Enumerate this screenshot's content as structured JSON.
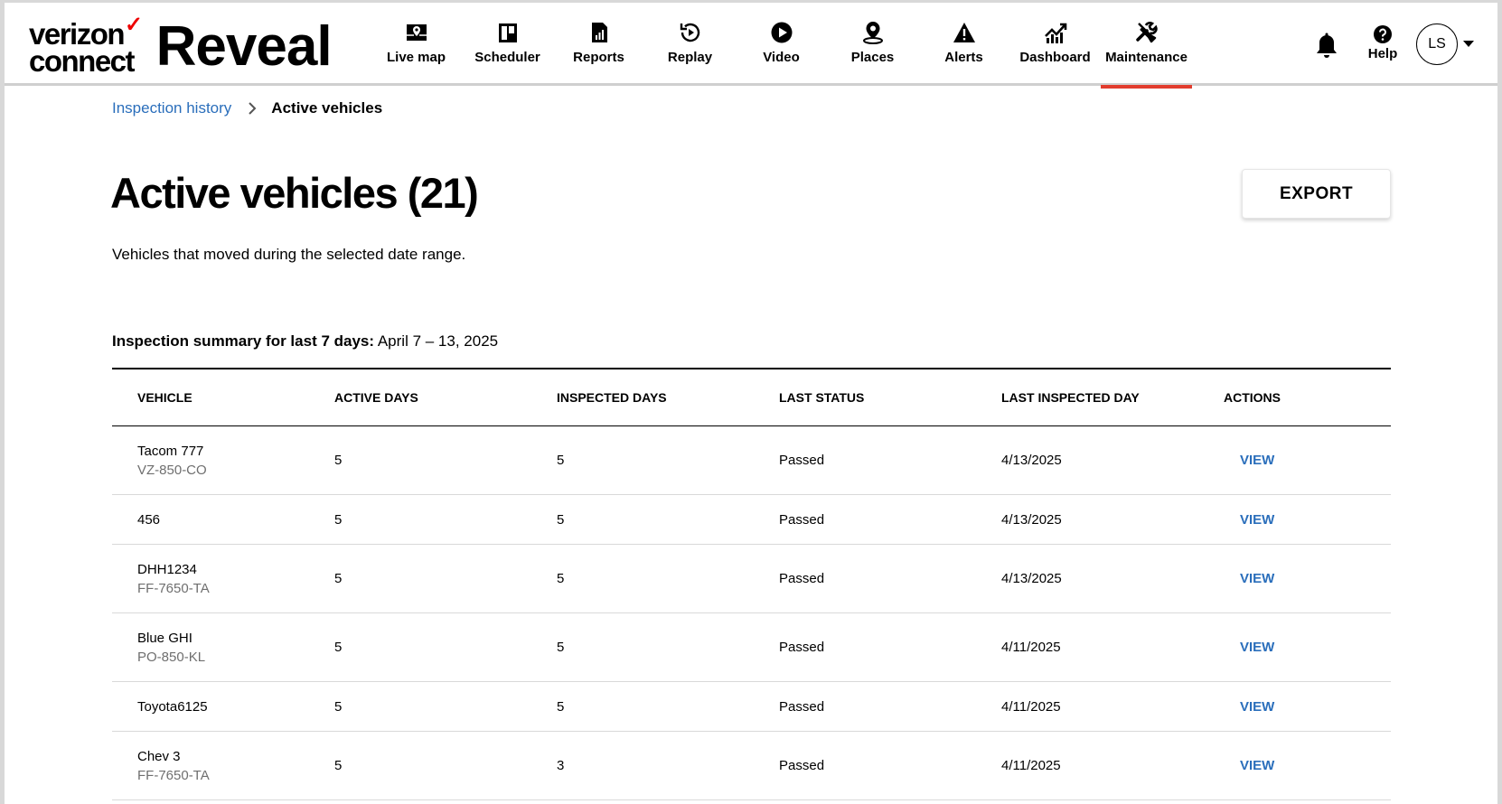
{
  "brand": {
    "logo_line1": "verizon",
    "logo_line2": "connect",
    "product": "Reveal"
  },
  "nav": [
    {
      "label": "Live map",
      "icon": "map-icon"
    },
    {
      "label": "Scheduler",
      "icon": "scheduler-icon"
    },
    {
      "label": "Reports",
      "icon": "reports-icon"
    },
    {
      "label": "Replay",
      "icon": "replay-icon"
    },
    {
      "label": "Video",
      "icon": "video-play-icon"
    },
    {
      "label": "Places",
      "icon": "places-pin-icon"
    },
    {
      "label": "Alerts",
      "icon": "alert-icon"
    },
    {
      "label": "Dashboard",
      "icon": "dashboard-icon"
    },
    {
      "label": "Maintenance",
      "icon": "maintenance-icon",
      "active": true
    }
  ],
  "header_right": {
    "help_label": "Help",
    "avatar_initials": "LS"
  },
  "breadcrumb": {
    "parent": "Inspection history",
    "current": "Active vehicles"
  },
  "page": {
    "title": "Active vehicles (21)",
    "subtitle": "Vehicles that moved during the selected date range.",
    "export_label": "EXPORT",
    "summary_label": "Inspection summary for last 7 days:",
    "summary_range": "April 7 – 13, 2025"
  },
  "table": {
    "columns": [
      "VEHICLE",
      "ACTIVE DAYS",
      "INSPECTED DAYS",
      "LAST STATUS",
      "LAST INSPECTED DAY",
      "ACTIONS"
    ],
    "rows": [
      {
        "vehicle": "Tacom 777",
        "plate": "VZ-850-CO",
        "active_days": "5",
        "inspected_days": "5",
        "status": "Passed",
        "last_day": "4/13/2025",
        "action": "VIEW"
      },
      {
        "vehicle": "456",
        "plate": "",
        "active_days": "5",
        "inspected_days": "5",
        "status": "Passed",
        "last_day": "4/13/2025",
        "action": "VIEW"
      },
      {
        "vehicle": "DHH1234",
        "plate": "FF-7650-TA",
        "active_days": "5",
        "inspected_days": "5",
        "status": "Passed",
        "last_day": "4/13/2025",
        "action": "VIEW"
      },
      {
        "vehicle": "Blue GHI",
        "plate": "PO-850-KL",
        "active_days": "5",
        "inspected_days": "5",
        "status": "Passed",
        "last_day": "4/11/2025",
        "action": "VIEW"
      },
      {
        "vehicle": "Toyota6125",
        "plate": "",
        "active_days": "5",
        "inspected_days": "5",
        "status": "Passed",
        "last_day": "4/11/2025",
        "action": "VIEW"
      },
      {
        "vehicle": "Chev 3",
        "plate": "FF-7650-TA",
        "active_days": "5",
        "inspected_days": "3",
        "status": "Passed",
        "last_day": "4/11/2025",
        "action": "VIEW"
      }
    ]
  },
  "colors": {
    "link": "#2a6ebb",
    "active_tab_underline": "#e23c2e",
    "logo_check": "#ee0000"
  }
}
